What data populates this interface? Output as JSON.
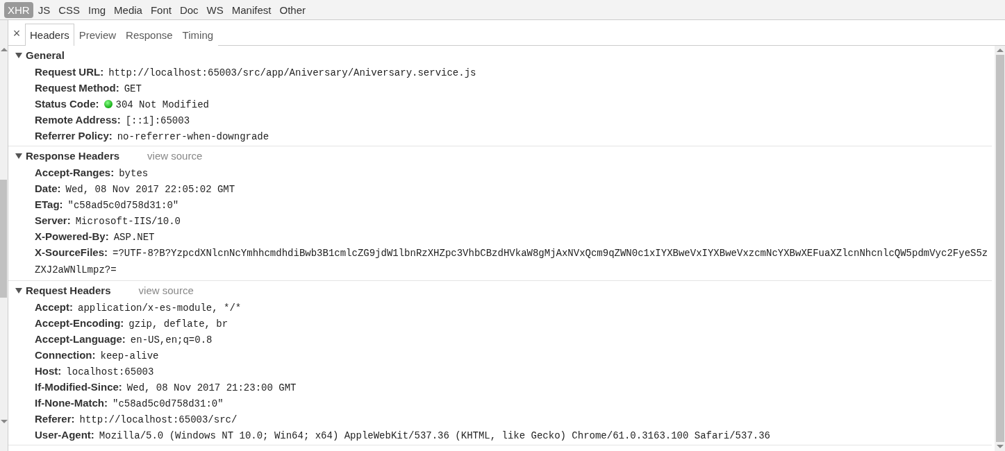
{
  "filters": [
    {
      "label": "XHR",
      "selected": true
    },
    {
      "label": "JS",
      "selected": false
    },
    {
      "label": "CSS",
      "selected": false
    },
    {
      "label": "Img",
      "selected": false
    },
    {
      "label": "Media",
      "selected": false
    },
    {
      "label": "Font",
      "selected": false
    },
    {
      "label": "Doc",
      "selected": false
    },
    {
      "label": "WS",
      "selected": false
    },
    {
      "label": "Manifest",
      "selected": false
    },
    {
      "label": "Other",
      "selected": false
    }
  ],
  "close": "×",
  "tabs": [
    {
      "label": "Headers",
      "selected": true
    },
    {
      "label": "Preview",
      "selected": false
    },
    {
      "label": "Response",
      "selected": false
    },
    {
      "label": "Timing",
      "selected": false
    }
  ],
  "sections": [
    {
      "title": "General",
      "expanded": true,
      "headers": [
        {
          "kind": "plain",
          "name": "Request URL:",
          "value": "http://localhost:65003/src/app/Aniversary/Aniversary.service.js"
        },
        {
          "kind": "plain",
          "name": "Request Method:",
          "value": "GET"
        },
        {
          "kind": "status",
          "name": "Status Code:",
          "value": "304 Not Modified"
        },
        {
          "kind": "plain",
          "name": "Remote Address:",
          "value": "[::1]:65003"
        },
        {
          "kind": "plain",
          "name": "Referrer Policy:",
          "value": "no-referrer-when-downgrade"
        }
      ]
    },
    {
      "title": "Response Headers",
      "link": "view source",
      "expanded": true,
      "headers": [
        {
          "kind": "plain",
          "name": "Accept-Ranges:",
          "value": "bytes"
        },
        {
          "kind": "plain",
          "name": "Date:",
          "value": "Wed, 08 Nov 2017 22:05:02 GMT"
        },
        {
          "kind": "plain",
          "name": "ETag:",
          "value": "\"c58ad5c0d758d31:0\""
        },
        {
          "kind": "plain",
          "name": "Server:",
          "value": "Microsoft-IIS/10.0"
        },
        {
          "kind": "plain",
          "name": "X-Powered-By:",
          "value": "ASP.NET"
        },
        {
          "kind": "wrapped",
          "name": "X-SourceFiles:",
          "value": "=?UTF-8?B?YzpcdXNlcnNcYmhhcmdhdiBwb3B1cmlcZG9jdW1lbnRzXHZpc3VhbCBzdHVkaW8gMjAxNVxQcm9qZWN0c1xIYXBweVxIYXBweVxzcmNcYXBwXEFuaXZlcnNhcnlcQW5pdmVyc2FyeS5zZXJ2aWNlLmpz?="
        }
      ]
    },
    {
      "title": "Request Headers",
      "link": "view source",
      "expanded": true,
      "headers": [
        {
          "kind": "plain",
          "name": "Accept:",
          "value": "application/x-es-module, */*"
        },
        {
          "kind": "plain",
          "name": "Accept-Encoding:",
          "value": "gzip, deflate, br"
        },
        {
          "kind": "plain",
          "name": "Accept-Language:",
          "value": "en-US,en;q=0.8"
        },
        {
          "kind": "plain",
          "name": "Connection:",
          "value": "keep-alive"
        },
        {
          "kind": "plain",
          "name": "Host:",
          "value": "localhost:65003"
        },
        {
          "kind": "plain",
          "name": "If-Modified-Since:",
          "value": "Wed, 08 Nov 2017 21:23:00 GMT"
        },
        {
          "kind": "plain",
          "name": "If-None-Match:",
          "value": "\"c58ad5c0d758d31:0\""
        },
        {
          "kind": "plain",
          "name": "Referer:",
          "value": "http://localhost:65003/src/"
        },
        {
          "kind": "plain",
          "name": "User-Agent:",
          "value": "Mozilla/5.0 (Windows NT 10.0; Win64; x64) AppleWebKit/537.36 (KHTML, like Gecko) Chrome/61.0.3163.100 Safari/537.36"
        }
      ]
    }
  ]
}
